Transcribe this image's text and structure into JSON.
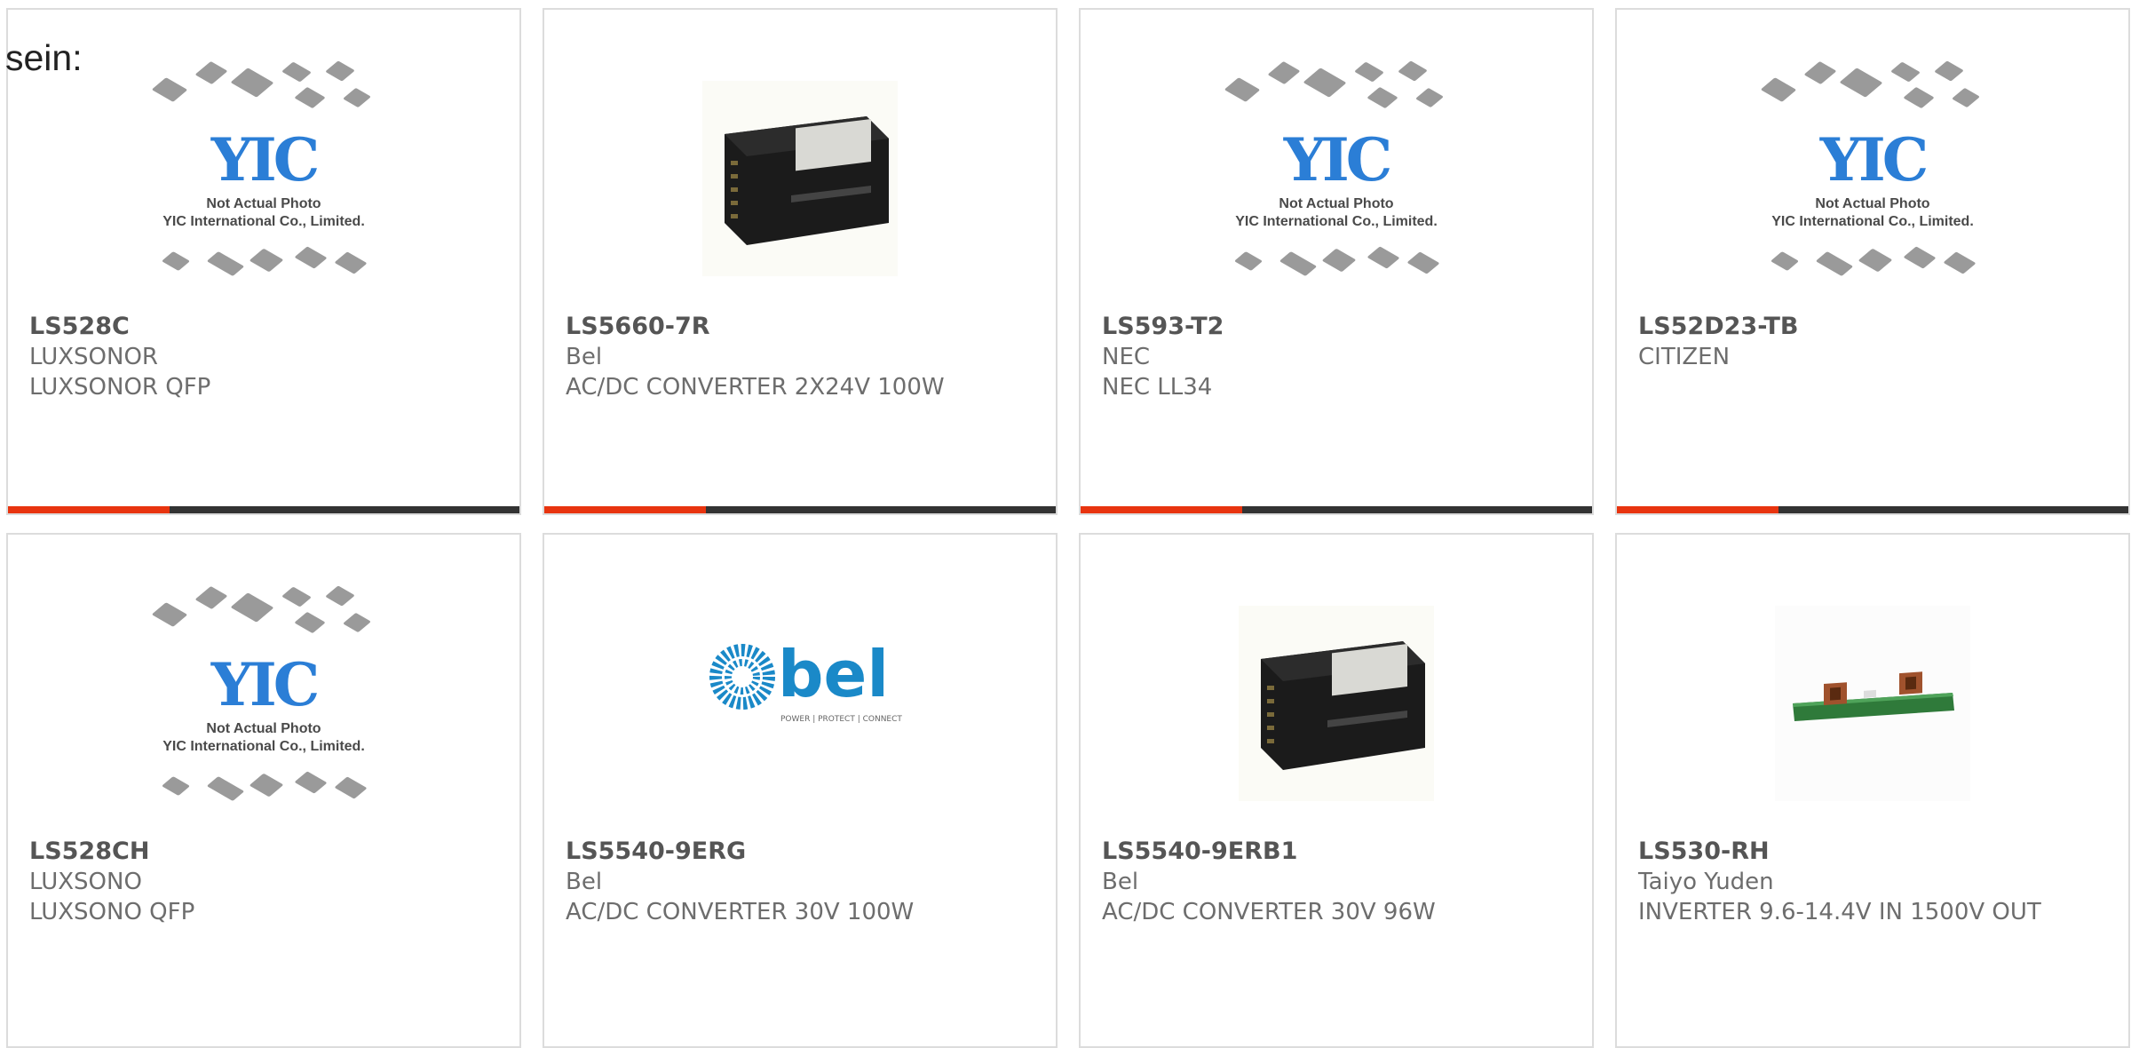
{
  "lead_text": "sein:",
  "placeholder": {
    "logo": "YIC",
    "line1": "Not Actual Photo",
    "line2": "YIC International Co., Limited."
  },
  "bel_logo": {
    "word": "bel",
    "tagline": "POWER | PROTECT | CONNECT"
  },
  "colors": {
    "accent": "#e8340f",
    "bar": "#333333",
    "border": "#dcdcdc",
    "yic_blue": "#2b7ed6",
    "bel_blue": "#1a89c8"
  },
  "products": [
    {
      "part": "LS528C",
      "manufacturer": "LUXSONOR",
      "description": "LUXSONOR QFP",
      "image": "yic-placeholder"
    },
    {
      "part": "LS5660-7R",
      "manufacturer": "Bel",
      "description": "AC/DC CONVERTER 2X24V 100W",
      "image": "power-supply-photo"
    },
    {
      "part": "LS593-T2",
      "manufacturer": "NEC",
      "description": "NEC LL34",
      "image": "yic-placeholder"
    },
    {
      "part": "LS52D23-TB",
      "manufacturer": "CITIZEN",
      "description": "",
      "image": "yic-placeholder"
    },
    {
      "part": "LS528CH",
      "manufacturer": "LUXSONO",
      "description": "LUXSONO QFP",
      "image": "yic-placeholder"
    },
    {
      "part": "LS5540-9ERG",
      "manufacturer": "Bel",
      "description": "AC/DC CONVERTER 30V 100W",
      "image": "bel-logo"
    },
    {
      "part": "LS5540-9ERB1",
      "manufacturer": "Bel",
      "description": "AC/DC CONVERTER 30V 96W",
      "image": "power-supply-photo"
    },
    {
      "part": "LS530-RH",
      "manufacturer": "Taiyo Yuden",
      "description": "INVERTER 9.6-14.4V IN 1500V OUT",
      "image": "inverter-board-photo"
    }
  ]
}
